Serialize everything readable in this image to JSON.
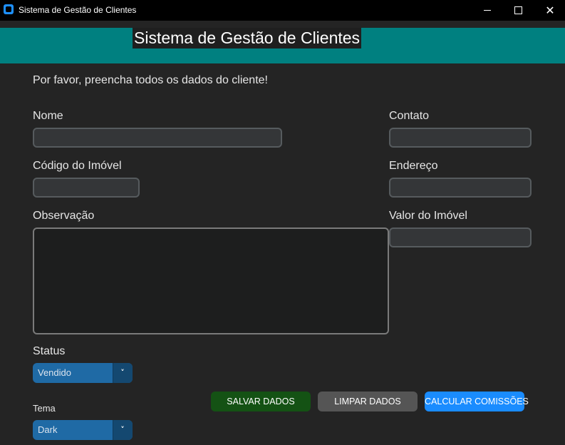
{
  "window": {
    "title": "Sistema de Gestão de Clientes",
    "icon": "app-icon",
    "controls": {
      "minimize": "minimize-icon",
      "maximize": "maximize-icon",
      "close": "close-icon"
    }
  },
  "header": {
    "title": "Sistema de Gestão de Clientes",
    "band_color": "#008080"
  },
  "instruction": "Por favor, preencha todos os dados do cliente!",
  "fields": {
    "nome": {
      "label": "Nome",
      "value": ""
    },
    "contato": {
      "label": "Contato",
      "value": ""
    },
    "codigo_imovel": {
      "label": "Código do Imóvel",
      "value": ""
    },
    "endereco": {
      "label": "Endereço",
      "value": ""
    },
    "observacao": {
      "label": "Observação",
      "value": ""
    },
    "valor_imovel": {
      "label": "Valor do Imóvel",
      "value": ""
    }
  },
  "status": {
    "label": "Status",
    "selected": "Vendido"
  },
  "tema": {
    "label": "Tema",
    "selected": "Dark"
  },
  "buttons": {
    "salvar": {
      "label": "SALVAR DADOS",
      "color": "#145214"
    },
    "limpar": {
      "label": "LIMPAR DADOS",
      "color": "#555555"
    },
    "calcular": {
      "label": "CALCULAR COMISSÕES",
      "color": "#1a8cff"
    }
  }
}
